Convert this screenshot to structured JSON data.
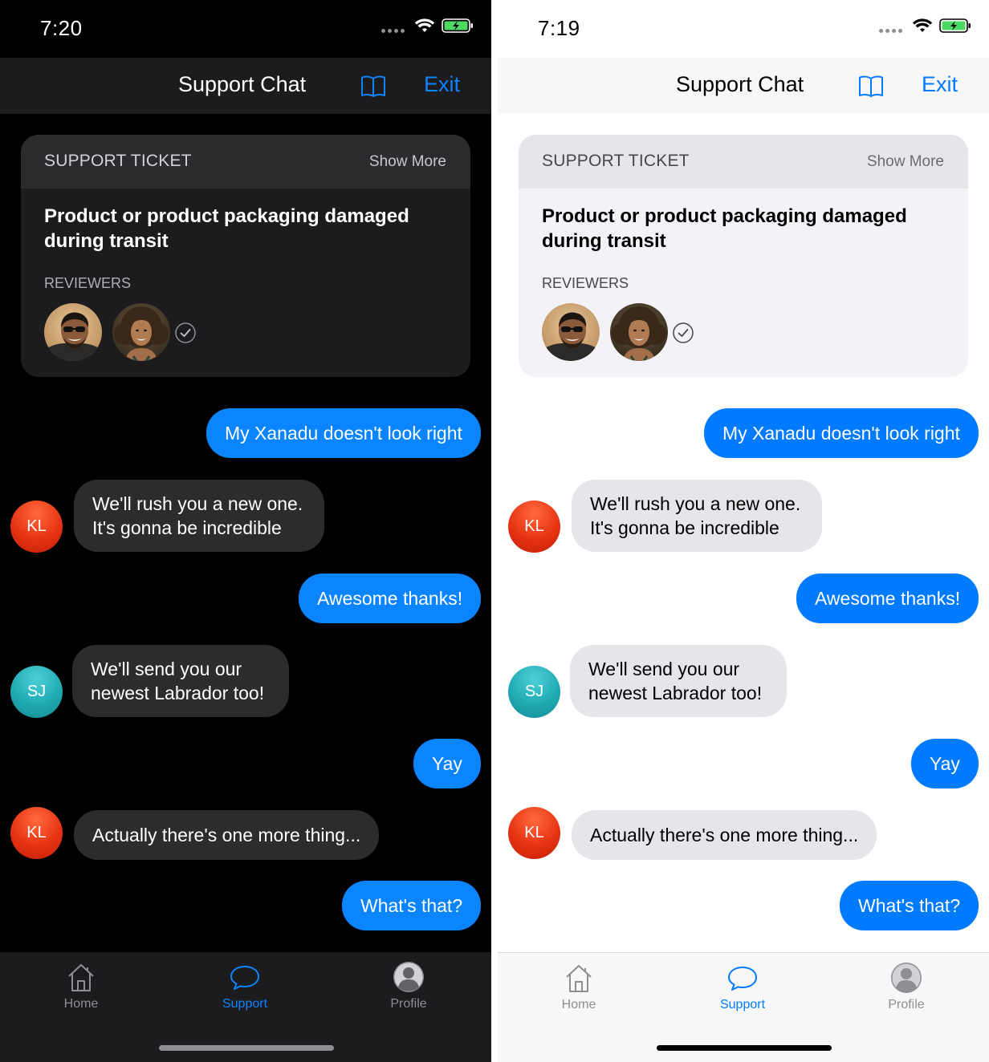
{
  "screens": [
    {
      "theme": "dark",
      "status": {
        "time": "7:20"
      },
      "nav": {
        "title": "Support Chat",
        "exit": "Exit"
      },
      "ticket": {
        "label": "SUPPORT TICKET",
        "show_more": "Show More",
        "title": "Product or product packaging damaged during transit",
        "reviewers_label": "REVIEWERS"
      },
      "messages": [
        {
          "from": "me",
          "text": "My Xanadu doesn't look right"
        },
        {
          "from": "KL",
          "lines": [
            "We'll rush you a new one.",
            "It's gonna be incredible"
          ]
        },
        {
          "from": "me",
          "text": "Awesome thanks!"
        },
        {
          "from": "SJ",
          "lines": [
            "We'll send you our",
            "newest Labrador too!"
          ]
        },
        {
          "from": "me",
          "text": "Yay"
        },
        {
          "from": "KL",
          "text": "Actually there's one more thing..."
        },
        {
          "from": "me",
          "text": "What's that?"
        }
      ],
      "tabs": [
        {
          "label": "Home",
          "icon": "home-icon",
          "active": false
        },
        {
          "label": "Support",
          "icon": "chat-bubble-icon",
          "active": true
        },
        {
          "label": "Profile",
          "icon": "profile-icon",
          "active": false
        }
      ]
    },
    {
      "theme": "light",
      "status": {
        "time": "7:19"
      },
      "nav": {
        "title": "Support Chat",
        "exit": "Exit"
      },
      "ticket": {
        "label": "SUPPORT TICKET",
        "show_more": "Show More",
        "title": "Product or product packaging damaged during transit",
        "reviewers_label": "REVIEWERS"
      },
      "messages": [
        {
          "from": "me",
          "text": "My Xanadu doesn't look right"
        },
        {
          "from": "KL",
          "lines": [
            "We'll rush you a new one.",
            "It's gonna be incredible"
          ]
        },
        {
          "from": "me",
          "text": "Awesome thanks!"
        },
        {
          "from": "SJ",
          "lines": [
            "We'll send you our",
            "newest Labrador too!"
          ]
        },
        {
          "from": "me",
          "text": "Yay"
        },
        {
          "from": "KL",
          "text": "Actually there's one more thing..."
        },
        {
          "from": "me",
          "text": "What's that?"
        }
      ],
      "tabs": [
        {
          "label": "Home",
          "icon": "home-icon",
          "active": false
        },
        {
          "label": "Support",
          "icon": "chat-bubble-icon",
          "active": true
        },
        {
          "label": "Profile",
          "icon": "profile-icon",
          "active": false
        }
      ]
    }
  ],
  "colors": {
    "accent_dark": "#0a84ff",
    "accent_light": "#007aff",
    "kl_avatar": "#e63312",
    "sj_avatar": "#20aab4",
    "battery_charging": "#4cd964"
  }
}
